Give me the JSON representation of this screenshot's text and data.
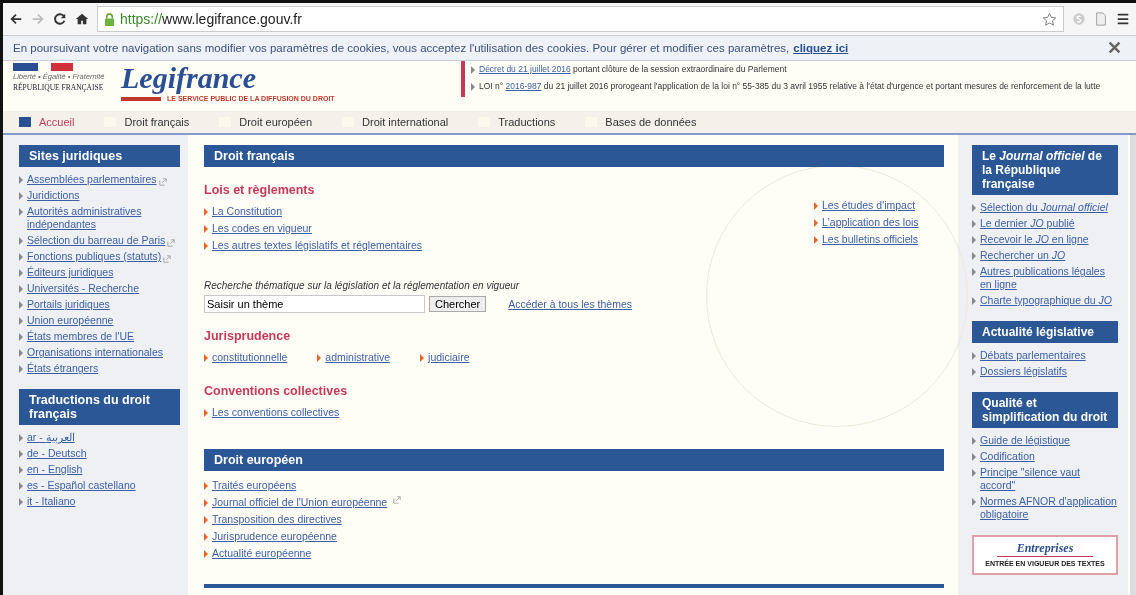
{
  "browser": {
    "url_scheme": "https://",
    "url_host": "www.legifrance.gouv.fr"
  },
  "cookie_bar": {
    "text": "En poursuivant votre navigation sans modifier vos paramètres de cookies, vous acceptez l'utilisation des cookies. Pour gérer et modifier ces paramètres,",
    "link": "cliquez ici",
    "close": "✕"
  },
  "header": {
    "motto": "Liberté • Égalité • Fraternité",
    "republic": "RÉPUBLIQUE FRANÇAISE",
    "logo": "Legifrance",
    "tagline": "LE SERVICE PUBLIC DE LA DIFFUSION DU DROIT",
    "news": [
      {
        "link": "Décret du 21 juillet 2016",
        "suffix": " portant clôture de la session extraordinaire du Parlement"
      },
      {
        "prefix": "LOI n° ",
        "link": "2016-987",
        "suffix": " du 21 juillet 2016 prorogeant l'application de la loi n° 55-385 du 3 avril 1955 relative à l'état d'urgence et portant mesures de renforcement de la lutte"
      }
    ]
  },
  "nav": [
    {
      "label": "Accueil",
      "selected": true
    },
    {
      "label": "Droit français",
      "selected": false
    },
    {
      "label": "Droit européen",
      "selected": false
    },
    {
      "label": "Droit international",
      "selected": false
    },
    {
      "label": "Traductions",
      "selected": false
    },
    {
      "label": "Bases de données",
      "selected": false
    }
  ],
  "left": [
    {
      "title": "Sites juridiques",
      "items": [
        {
          "label": "Assemblées parlementaires",
          "external": true
        },
        {
          "label": "Juridictions",
          "external": false
        },
        {
          "label": "Autorités administratives indépendantes",
          "external": false
        },
        {
          "label": "Sélection du barreau de Paris",
          "external": true
        },
        {
          "label": "Fonctions publiques (statuts)",
          "external": true
        },
        {
          "label": "Éditeurs juridiques",
          "external": false
        },
        {
          "label": "Universités - Recherche",
          "external": false
        },
        {
          "label": "Portails juridiques",
          "external": false
        },
        {
          "label": "Union européenne",
          "external": false
        },
        {
          "label": "États membres de l'UE",
          "external": false
        },
        {
          "label": "Organisations internationales",
          "external": false
        },
        {
          "label": "États étrangers",
          "external": false
        }
      ]
    },
    {
      "title": "Traductions du droit français",
      "items": [
        {
          "label": "ar - العربية",
          "external": false
        },
        {
          "label": "de - Deutsch",
          "external": false
        },
        {
          "label": "en - English",
          "external": false
        },
        {
          "label": "es - Español castellano",
          "external": false
        },
        {
          "label": "it - Italiano",
          "external": false
        }
      ]
    }
  ],
  "center": {
    "droit_francais": {
      "title": "Droit français",
      "lois": {
        "heading": "Lois et règlements",
        "links": [
          "La Constitution",
          "Les codes en vigueur",
          "Les autres textes législatifs et réglementaires"
        ],
        "side_links": [
          "Les études d'impact",
          "L'application des lois",
          "Les bulletins officiels"
        ]
      },
      "search": {
        "caption": "Recherche thématique sur la législation et la réglementation en vigueur",
        "value": "Saisir un thème",
        "button": "Chercher",
        "link": "Accéder à tous les thèmes"
      },
      "jurisprudence": {
        "heading": "Jurisprudence",
        "links": [
          "constitutionnelle",
          "administrative",
          "judiciaire"
        ]
      },
      "conventions": {
        "heading": "Conventions collectives",
        "links": [
          "Les conventions collectives"
        ]
      }
    },
    "droit_europeen": {
      "title": "Droit européen",
      "links": [
        {
          "label": "Traités européens",
          "external": false
        },
        {
          "label": "Journal officiel de l'Union européenne",
          "external": true
        },
        {
          "label": "Transposition des directives",
          "external": false
        },
        {
          "label": "Jurisprudence européenne",
          "external": false
        },
        {
          "label": "Actualité européenne",
          "external": false
        }
      ]
    }
  },
  "right": [
    {
      "title": "Le *Journal officiel* de la République française",
      "items": [
        "Sélection du *Journal officiel*",
        "Le dernier *JO* publié",
        "Recevoir le *JO* en ligne",
        "Rechercher un *JO*",
        "Autres publications légales en ligne",
        "Charte typographique du *JO*"
      ]
    },
    {
      "title": "Actualité législative",
      "items": [
        "Débats parlementaires",
        "Dossiers législatifs"
      ]
    },
    {
      "title": "Qualité et simplification du droit",
      "items": [
        "Guide de légistique",
        "Codification",
        "Principe \"silence vaut accord\"",
        "Normes AFNOR d'application obligatoire"
      ]
    }
  ],
  "promo": {
    "title": "Entreprises",
    "subtitle": "ENTRÉE EN VIGUEUR DES TEXTES"
  }
}
